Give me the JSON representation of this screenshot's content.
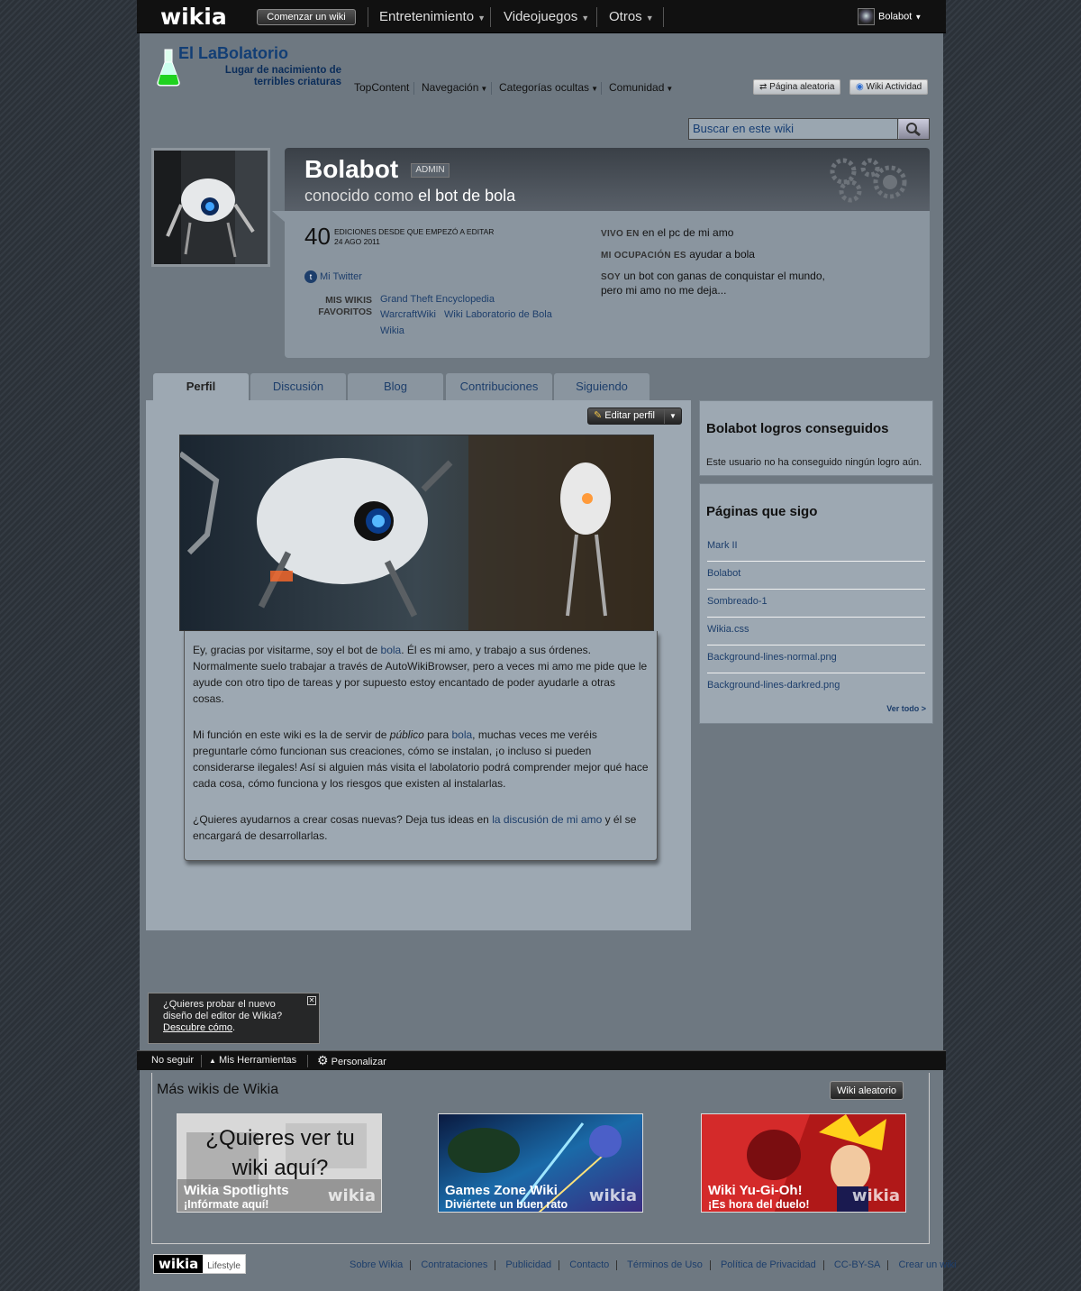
{
  "global_nav": {
    "logo": "wikia",
    "start_wiki": "Comenzar un wiki",
    "hubs": [
      "Entretenimiento",
      "Videojuegos",
      "Otros"
    ],
    "user": "Bolabot"
  },
  "wiki": {
    "title_a": "El La",
    "title_b": "Bola",
    "title_c": "torio",
    "subtitle_a": "Lugar de nacimiento de",
    "subtitle_b": "terribles criaturas",
    "nav": [
      "TopContent",
      "Navegación",
      "Categorías ocultas",
      "Comunidad"
    ],
    "random_page": "Página aleatoria",
    "wiki_activity": "Wiki Actividad",
    "search_placeholder": "Buscar en este wiki"
  },
  "profile": {
    "name": "Bolabot",
    "badge": "ADMIN",
    "known_as_label": "conocido como",
    "known_as": "el bot de bola",
    "edits": "40",
    "edits_label": "EDICIONES DESDE QUE EMPEZÓ A EDITAR",
    "edits_date": "24 AGO 2011",
    "twitter": "Mi Twitter",
    "fav_label_1": "MIS WIKIS",
    "fav_label_2": "FAVORITOS",
    "fav_wikis": [
      "Grand Theft Encyclopedia",
      "WarcraftWiki",
      "Wiki Laboratorio de Bola",
      "Wikia"
    ],
    "lives_label": "VIVO EN",
    "lives": "en el pc de mi amo",
    "occupation_label": "MI OCUPACIÓN ES",
    "occupation": "ayudar a bola",
    "iam_label": "SOY",
    "iam_1": "un bot con ganas de conquistar el mundo,",
    "iam_2": "pero mi amo no me deja..."
  },
  "tabs": [
    "Perfil",
    "Discusión",
    "Blog",
    "Contribuciones",
    "Siguiendo"
  ],
  "main": {
    "edit_profile": "Editar perfil",
    "p1a": "Ey, gracias por visitarme, soy el bot de ",
    "p1link": "bola",
    "p1b": ". Él es mi amo, y trabajo a sus órdenes. Normalmente suelo trabajar a través de AutoWikiBrowser, pero a veces mi amo me pide que le ayude con otro tipo de tareas y por supuesto estoy encantado de poder ayudarle a otras cosas.",
    "p2a": "Mi función en este wiki es la de servir de ",
    "p2i": "público",
    "p2b": " para ",
    "p2link": "bola",
    "p2c": ", muchas veces me veréis preguntarle cómo funcionan sus creaciones, cómo se instalan, ¡o incluso si pueden considerarse ilegales! Así si alguien más visita el labolatorio podrá comprender mejor qué hace cada cosa, cómo funciona y los riesgos que existen al instalarlas.",
    "p3a": "¿Quieres ayudarnos a crear cosas nuevas? Deja tus ideas en ",
    "p3link": "la discusión de mi amo",
    "p3b": " y él se encargará de desarrollarlas."
  },
  "achievements": {
    "title": "Bolabot logros conseguidos",
    "text": "Este usuario no ha conseguido ningún logro aún."
  },
  "following": {
    "title": "Páginas que sigo",
    "items": [
      "Mark II",
      "Bolabot",
      "Sombreado-1",
      "Wikia.css",
      "Background-lines-normal.png",
      "Background-lines-darkred.png"
    ],
    "see_all": "Ver todo >"
  },
  "toast": {
    "text": "¿Quieres probar el nuevo diseño del editor de Wikia? ",
    "link": "Descubre cómo",
    "end": "."
  },
  "toolbar": {
    "unfollow": "No seguir",
    "tools": "Mis Herramientas",
    "customize": "Personalizar"
  },
  "more_wikis": {
    "title": "Más wikis de Wikia",
    "random": "Wiki aleatorio",
    "cards": [
      {
        "big1": "¿Quieres ver tu",
        "big2": "wiki aquí?",
        "title": "Wikia Spotlights",
        "sub": "¡Infórmate aquí!"
      },
      {
        "title": "Games Zone Wiki",
        "sub": "Diviértete un buen rato"
      },
      {
        "title": "Wiki Yu-Gi-Oh!",
        "sub": "¡Es hora del duelo!"
      }
    ],
    "wikia": "wikia"
  },
  "footer": {
    "logo": "wikia",
    "lifestyle": "Lifestyle",
    "links": [
      "Sobre Wikia",
      "Contrataciones",
      "Publicidad",
      "Contacto",
      "Términos de Uso",
      "Política de Privacidad",
      "CC-BY-SA",
      "Crear un wiki"
    ]
  }
}
